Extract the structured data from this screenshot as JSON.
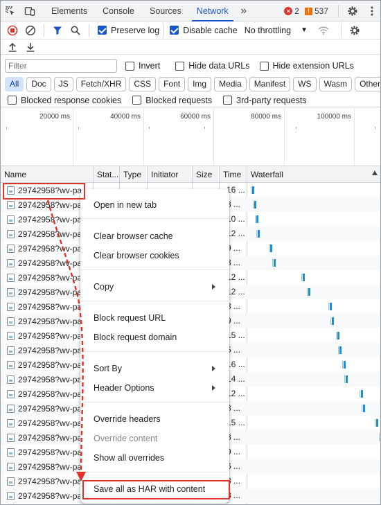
{
  "tabbar": {
    "tabs": [
      {
        "label": "Elements",
        "active": false
      },
      {
        "label": "Console",
        "active": false
      },
      {
        "label": "Sources",
        "active": false
      },
      {
        "label": "Network",
        "active": true
      }
    ],
    "error_count": "2",
    "warning_count": "537"
  },
  "toolbar": {
    "preserve_log_label": "Preserve log",
    "preserve_log_checked": true,
    "disable_cache_label": "Disable cache",
    "disable_cache_checked": true,
    "throttling_value": "No throttling"
  },
  "filter": {
    "placeholder": "Filter",
    "invert_label": "Invert",
    "hide_data_urls_label": "Hide data URLs",
    "hide_extension_urls_label": "Hide extension URLs"
  },
  "type_filters": [
    {
      "label": "All",
      "active": true
    },
    {
      "label": "Doc",
      "active": false
    },
    {
      "label": "JS",
      "active": false
    },
    {
      "label": "Fetch/XHR",
      "active": false
    },
    {
      "label": "CSS",
      "active": false
    },
    {
      "label": "Font",
      "active": false
    },
    {
      "label": "Img",
      "active": false
    },
    {
      "label": "Media",
      "active": false
    },
    {
      "label": "Manifest",
      "active": false
    },
    {
      "label": "WS",
      "active": false
    },
    {
      "label": "Wasm",
      "active": false
    },
    {
      "label": "Other",
      "active": false
    }
  ],
  "options": {
    "blocked_response_cookies": "Blocked response cookies",
    "blocked_requests": "Blocked requests",
    "third_party_requests": "3rd-party requests"
  },
  "overview": {
    "labels": [
      "20000 ms",
      "40000 ms",
      "60000 ms",
      "80000 ms",
      "100000 ms"
    ]
  },
  "table": {
    "headers": {
      "name": "Name",
      "status": "Stat...",
      "type": "Type",
      "initiator": "Initiator",
      "size": "Size",
      "time": "Time",
      "waterfall": "Waterfall"
    },
    "rows": [
      {
        "name": "29742958?wv-pa",
        "time": "16 ..."
      },
      {
        "name": "29742958?wv-pa",
        "time": "8 ..."
      },
      {
        "name": "29742958?wv-pa",
        "time": "10 ..."
      },
      {
        "name": "29742958?wv-pa",
        "time": "12 ..."
      },
      {
        "name": "29742958?wv-pa",
        "time": "9 ..."
      },
      {
        "name": "29742958?wv-pa",
        "time": "8 ..."
      },
      {
        "name": "29742958?wv-pa",
        "time": "12 ..."
      },
      {
        "name": "29742958?wv-pa",
        "time": "12 ..."
      },
      {
        "name": "29742958?wv-pa",
        "time": "8 ..."
      },
      {
        "name": "29742958?wv-pa",
        "time": "9 ..."
      },
      {
        "name": "29742958?wv-pa",
        "time": "15 ..."
      },
      {
        "name": "29742958?wv-pa",
        "time": "5 ..."
      },
      {
        "name": "29742958?wv-pa",
        "time": "16 ..."
      },
      {
        "name": "29742958?wv-pa",
        "time": "14 ..."
      },
      {
        "name": "29742958?wv-pa",
        "time": "12 ..."
      },
      {
        "name": "29742958?wv-pa",
        "time": "8 ..."
      },
      {
        "name": "29742958?wv-pa",
        "time": "15 ..."
      },
      {
        "name": "29742958?wv-pa",
        "time": "8 ..."
      },
      {
        "name": "29742958?wv-pa",
        "time": "9 ..."
      },
      {
        "name": "29742958?wv-pa",
        "time": "6 ..."
      },
      {
        "name": "29742958?wv-pa",
        "time": "8 ..."
      },
      {
        "name": "29742958?wv-pa",
        "time": "8 ..."
      }
    ]
  },
  "context_menu": {
    "open_new_tab": "Open in new tab",
    "clear_cache": "Clear browser cache",
    "clear_cookies": "Clear browser cookies",
    "copy": "Copy",
    "block_url": "Block request URL",
    "block_domain": "Block request domain",
    "sort_by": "Sort By",
    "header_options": "Header Options",
    "override_headers": "Override headers",
    "override_content": "Override content",
    "show_overrides": "Show all overrides",
    "save_har": "Save all as HAR with content"
  },
  "colors": {
    "accent": "#1a56c9",
    "highlight": "#e0312b",
    "waterfall_bar": "#1a8fd6"
  }
}
